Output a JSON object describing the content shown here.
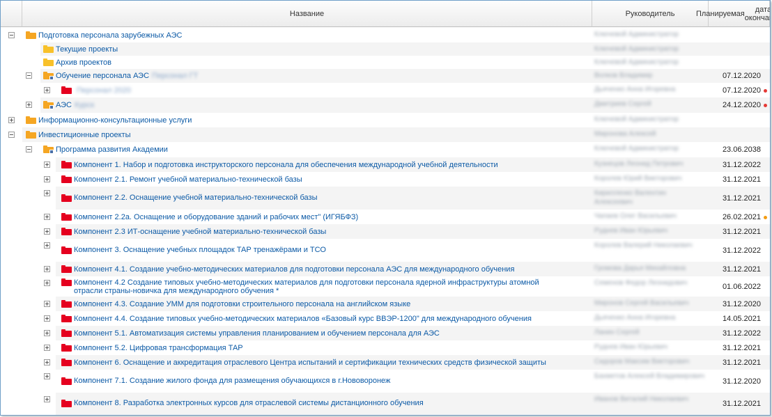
{
  "columns": {
    "name": "Название",
    "manager": "Руководитель",
    "date_line1": "Планируемая",
    "date_line2": "дата окончания"
  },
  "colors": {
    "link": "#0c5aa6",
    "overdue": "#e53935",
    "warning": "#f39c12"
  },
  "rows": [
    {
      "name": "Подготовка персонала зарубежных АЭС",
      "manager": "Ключевой Администратор",
      "date": ""
    },
    {
      "name": "Текущие проекты",
      "manager": "Ключевой Администратор",
      "date": ""
    },
    {
      "name": "Архив проектов",
      "manager": "Ключевой Администратор",
      "date": ""
    },
    {
      "name": "Обучение персонала АЭС",
      "blurred": "Персонал ГТ",
      "manager": "Волков Владимир",
      "date": "07.12.2020"
    },
    {
      "name": "",
      "blurred": "Персонал 2020",
      "manager": "Дьяченко Анна Игоревна",
      "date": "07.12.2020"
    },
    {
      "name": "АЭС",
      "blurred": "Курск",
      "manager": "Дмитриев Сергей",
      "date": "24.12.2020"
    },
    {
      "name": "Информационно-консультационные услуги",
      "manager": "Ключевой Администратор",
      "date": ""
    },
    {
      "name": "Инвестиционные проекты",
      "manager": "Миронова Алексей",
      "date": ""
    },
    {
      "name": "Программа развития Академии",
      "manager": "Ключевой Администратор",
      "date": "23.06.2038"
    },
    {
      "name": "Компонент 1. Набор и подготовка инструкторского персонала для обеспечения международной учебной деятельности",
      "manager": "Кузнецов Леонид Петрович",
      "date": "31.12.2022"
    },
    {
      "name": "Компонент 2.1. Ремонт учебной материально-технической базы",
      "manager": "Королев Юрий Викторович",
      "date": "31.12.2021"
    },
    {
      "name": "Компонент 2.2. Оснащение учебной материально-технической базы",
      "manager": "Кирилленко Валентин Алексеевич",
      "date": "31.12.2021"
    },
    {
      "name": "Компонент 2.2а. Оснащение и оборудование зданий и рабочих мест\" (ИГЯБФЗ)",
      "manager": "Чапаев Олег Васильевич",
      "date": "26.02.2021"
    },
    {
      "name": "Компонент 2.3 ИТ-оснащение учебной материально-технической базы",
      "manager": "Руднев Иван Юрьевич",
      "date": "31.12.2021"
    },
    {
      "name": "Компонент 3. Оснащение учебных площадок ТАР тренажёрами и ТСО",
      "manager": "Королев Валерий Николаевич",
      "date": "31.12.2022"
    },
    {
      "name": "Компонент 4.1. Создание учебно-методических материалов для подготовки персонала АЭС для международного обучения",
      "manager": "Громова Дарья Михайловна",
      "date": "31.12.2021"
    },
    {
      "name": "Компонент 4.2 Создание типовых учебно-методических материалов для подготовки персонала ядерной инфраструктуры атомной отрасли страны-новичка для международного обучения *",
      "manager": "Семенов Федор Леонидович",
      "date": "01.06.2022"
    },
    {
      "name": "Компонент 4.3. Создание УММ для подготовки строительного персонала на английском языке",
      "manager": "Миронов Сергей Васильевич",
      "date": "31.12.2020"
    },
    {
      "name": "Компонент 4.4. Создание типовых учебно-методических материалов «Базовый курс ВВЭР-1200\" для международного обучения",
      "manager": "Дьяченко Анна Игоревна",
      "date": "14.05.2021"
    },
    {
      "name": "Компонент 5.1. Автоматизация системы управления планированием и обучением персонала для АЭС",
      "manager": "Ланин Сергей",
      "date": "31.12.2022"
    },
    {
      "name": "Компонент 5.2. Цифровая трансформация ТАР",
      "manager": "Руднев Иван Юрьевич",
      "date": "31.12.2021"
    },
    {
      "name": "Компонент 6. Оснащение и аккредитация отраслевого Центра испытаний и сертификации технических средств физической защиты",
      "manager": "Сидоров Максим Викторович",
      "date": "31.12.2021"
    },
    {
      "name": "Компонент 7.1. Создание жилого фонда для размещения обучающихся в г.Нововоронеж",
      "manager": "Бахметов Алексей Владимирович",
      "date": "31.12.2020"
    },
    {
      "name": "Компонент 8. Разработка электронных курсов для отраслевой системы дистанционного обучения",
      "manager": "Иванов Виталий Николаевич",
      "date": "31.12.2021"
    }
  ]
}
